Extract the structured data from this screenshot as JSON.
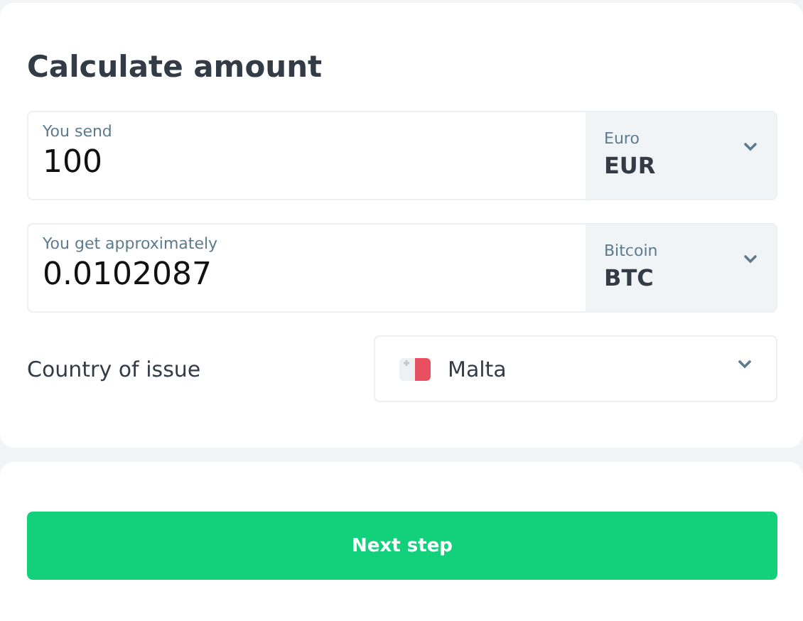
{
  "title": "Calculate amount",
  "amounts": [
    {
      "label": "You send",
      "value": "100",
      "currency_name": "Euro",
      "currency_code": "EUR"
    },
    {
      "label": "You get approximately",
      "value": "0.0102087",
      "currency_name": "Bitcoin",
      "currency_code": "BTC"
    }
  ],
  "country": {
    "label": "Country of issue",
    "value": "Malta"
  },
  "button": "Next step"
}
